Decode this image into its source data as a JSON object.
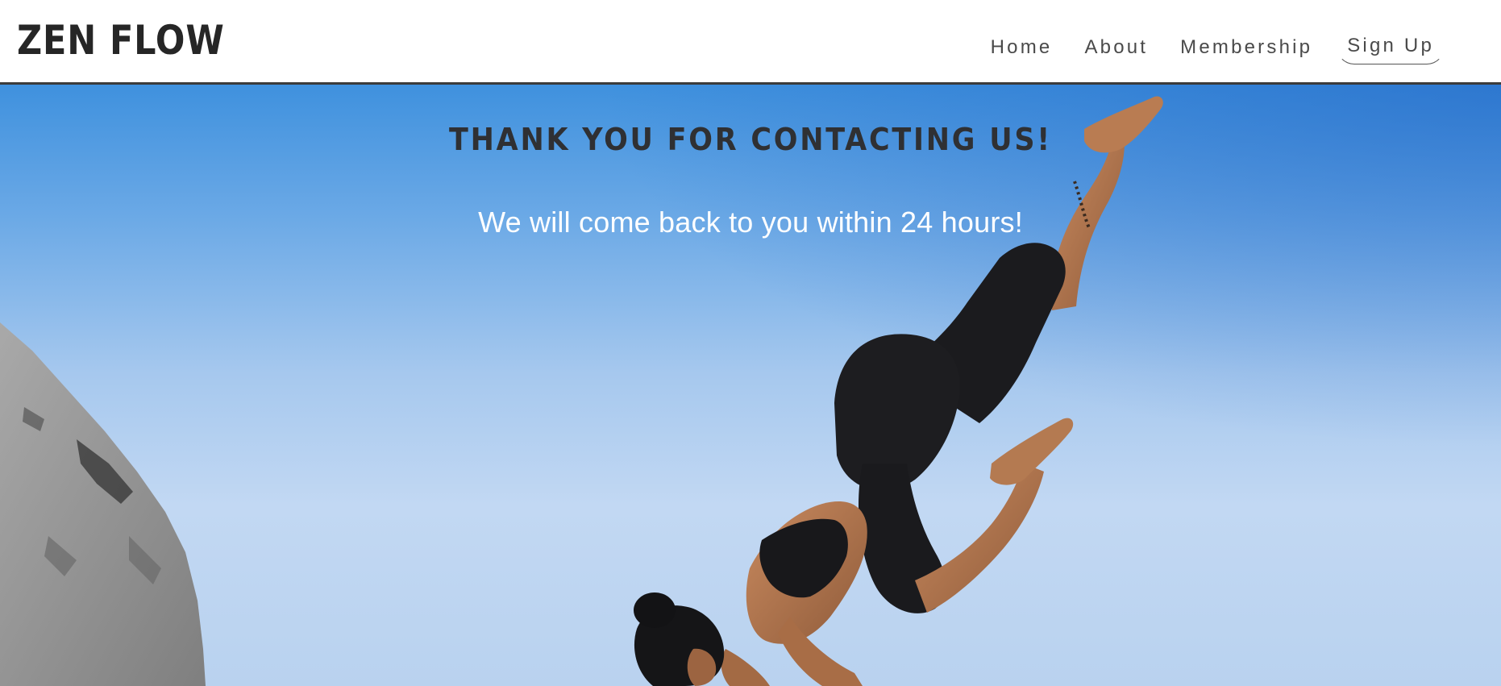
{
  "brand": {
    "name": "ZEN FLOW"
  },
  "nav": {
    "items": [
      {
        "label": "Home"
      },
      {
        "label": "About"
      },
      {
        "label": "Membership"
      },
      {
        "label": "Sign Up"
      }
    ]
  },
  "hero": {
    "title": "THANK YOU FOR CONTACTING US!",
    "subtitle": "We will come back to you within 24 hours!"
  },
  "colors": {
    "header_bg": "#ffffff",
    "header_border": "#3b3b3b",
    "title_text": "#2f3033",
    "subtitle_text": "#ffffff",
    "sky_top": "#3f91de",
    "sky_bottom": "#c2d8f3"
  }
}
